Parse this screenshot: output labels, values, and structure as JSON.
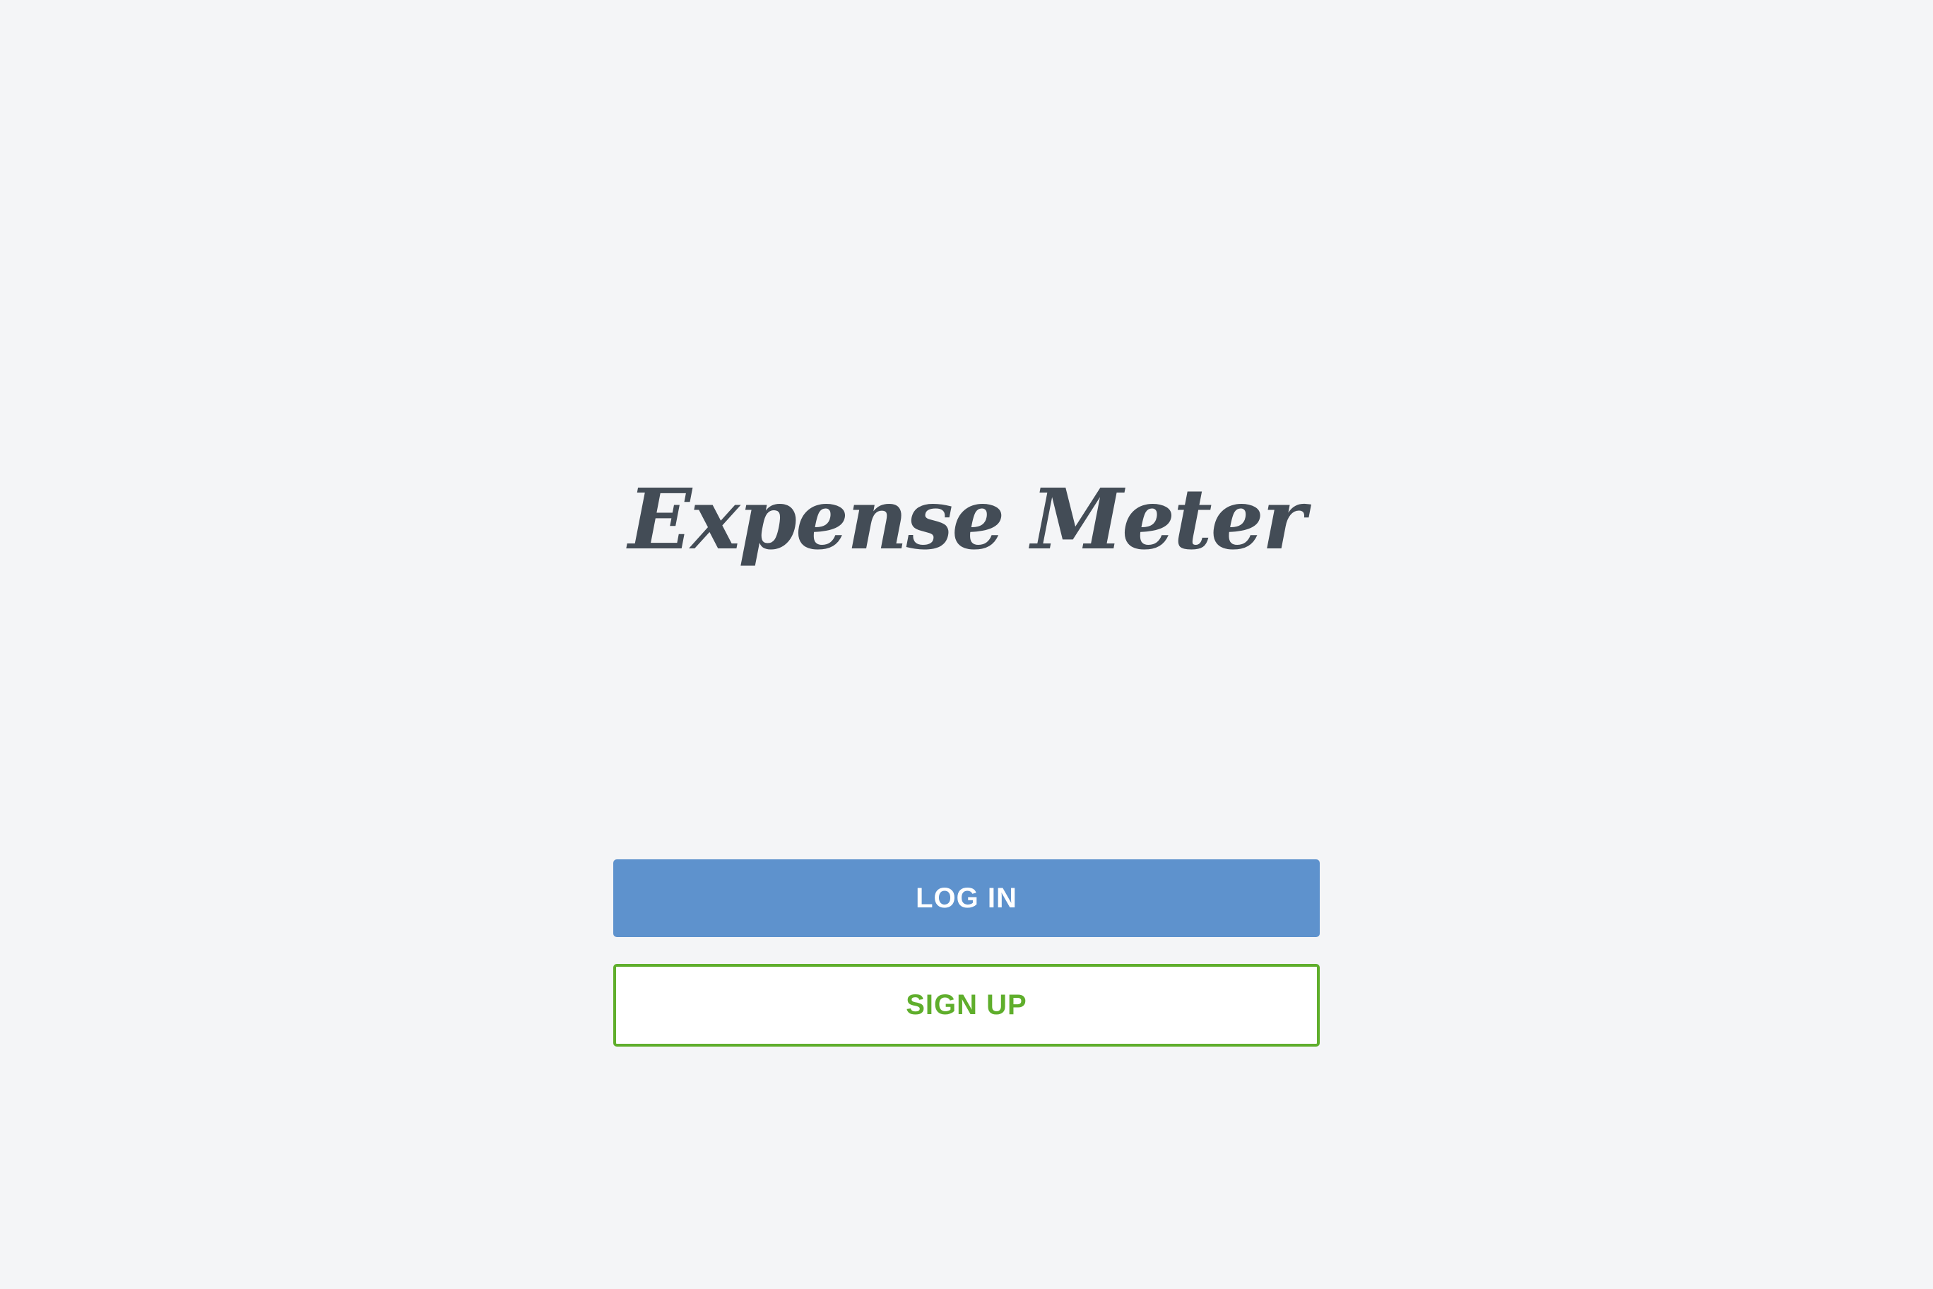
{
  "app": {
    "title": "Expense Meter"
  },
  "actions": {
    "login_label": "LOG IN",
    "signup_label": "SIGN UP"
  },
  "colors": {
    "background": "#f4f5f7",
    "logo_text": "#434c56",
    "login_button": "#5e92cd",
    "signup_accent": "#5fae2c"
  }
}
